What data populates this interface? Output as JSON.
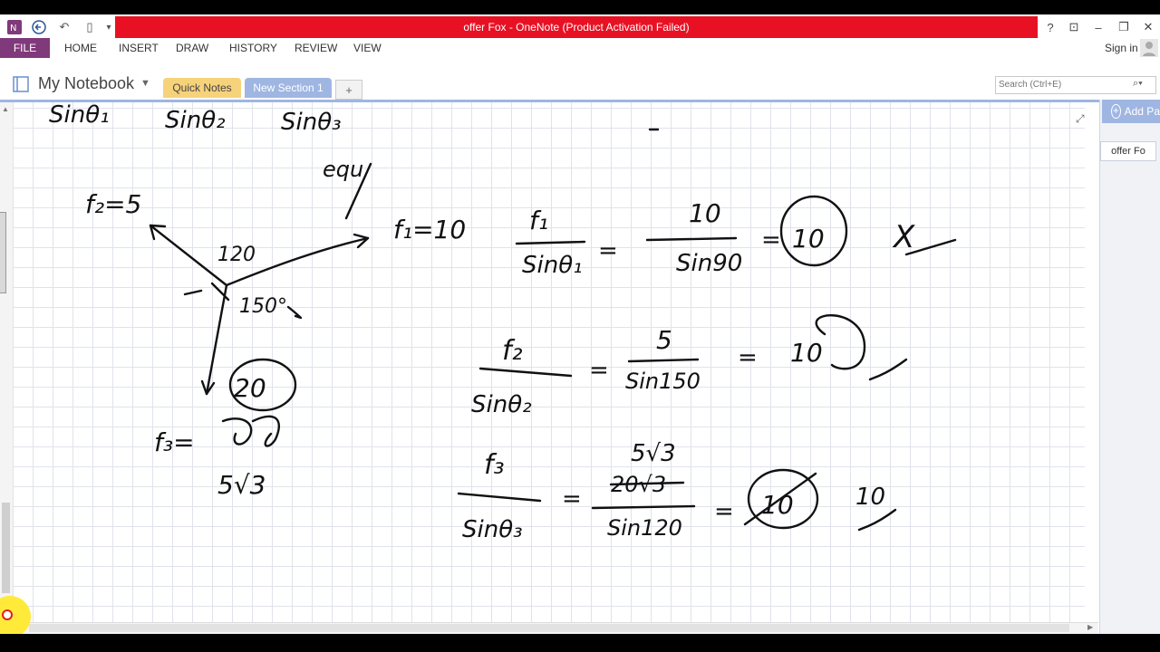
{
  "window": {
    "title": "offer Fox -  OneNote (Product Activation Failed)",
    "help": "?",
    "restore_ribbon": "⊡",
    "minimize": "–",
    "maximize": "❐",
    "close": "✕"
  },
  "qat": {
    "undo": "↶",
    "dock": "▯",
    "more": "▾"
  },
  "ribbon": {
    "file": "FILE",
    "tabs": [
      "HOME",
      "INSERT",
      "DRAW",
      "HISTORY",
      "REVIEW",
      "VIEW"
    ],
    "sign_in": "Sign in"
  },
  "notebook": {
    "title": "My Notebook",
    "sections": [
      {
        "label": "Quick Notes",
        "color": "#f6d27a"
      },
      {
        "label": "New Section 1",
        "color": "#9fb6e3"
      }
    ],
    "add_section": "+"
  },
  "search": {
    "placeholder": "Search (Ctrl+E)"
  },
  "pages": {
    "add_page": "Add Pa",
    "entries": [
      "offer Fo"
    ]
  },
  "ink": {
    "top_fragments": [
      "Sinθ₁",
      "Sinθ₂",
      "Sinθ₃"
    ],
    "equ": "equ",
    "f2_label": "f₂=5",
    "f1_label": "f₁=10",
    "angle_120": "120",
    "angle_150": "150°",
    "f3_label": "f₃=",
    "f3_value": "5√3",
    "circled_20": "20",
    "eq1": {
      "num": "f₁",
      "den": "Sinθ₁",
      "rnum": "10",
      "rden": "Sin90",
      "result": "10",
      "mark": "X"
    },
    "eq2": {
      "num": "f₂",
      "den": "Sinθ₂",
      "rnum": "5",
      "rden": "Sin150",
      "result": "10"
    },
    "eq3": {
      "num": "f₃",
      "den": "Sinθ₃",
      "rnum": "5√3",
      "rnum_struck": "20√3",
      "rden": "Sin120",
      "result_struck": "10",
      "result": "10"
    }
  }
}
